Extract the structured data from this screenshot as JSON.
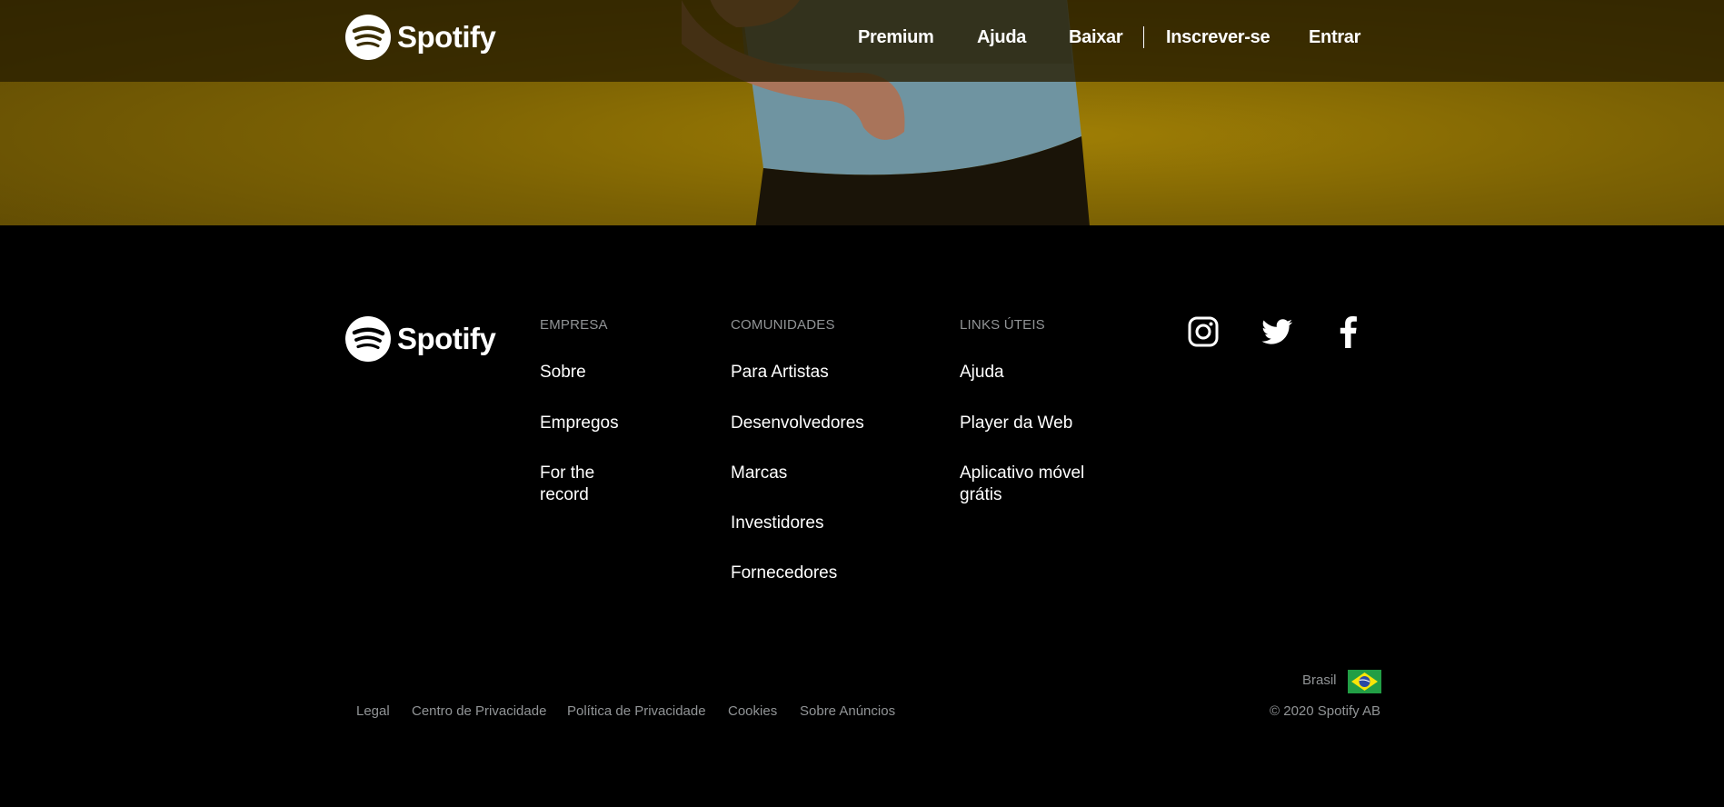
{
  "brand": {
    "name": "Spotify"
  },
  "nav": {
    "premium": "Premium",
    "help": "Ajuda",
    "download": "Baixar",
    "signup": "Inscrever-se",
    "login": "Entrar"
  },
  "footer": {
    "company": {
      "heading": "EMPRESA",
      "links": [
        "Sobre",
        "Empregos",
        "For the record"
      ]
    },
    "communities": {
      "heading": "COMUNIDADES",
      "links": [
        "Para Artistas",
        "Desenvolvedores",
        "Marcas",
        "Investidores",
        "Fornecedores"
      ]
    },
    "useful": {
      "heading": "LINKS ÚTEIS",
      "links": [
        "Ajuda",
        "Player da Web",
        "Aplicativo móvel grátis"
      ]
    },
    "social": [
      "instagram-icon",
      "twitter-icon",
      "facebook-icon"
    ],
    "legal": [
      "Legal",
      "Centro de Privacidade",
      "Política de Privacidade",
      "Cookies",
      "Sobre Anúncios"
    ],
    "country": "Brasil",
    "copyright": "© 2020 Spotify AB"
  },
  "colors": {
    "hero": "#7c6204",
    "background": "#000000",
    "muted": "#919496",
    "flag_green": "#229e45",
    "flag_yellow": "#f8e509",
    "flag_blue": "#2b49a3"
  }
}
